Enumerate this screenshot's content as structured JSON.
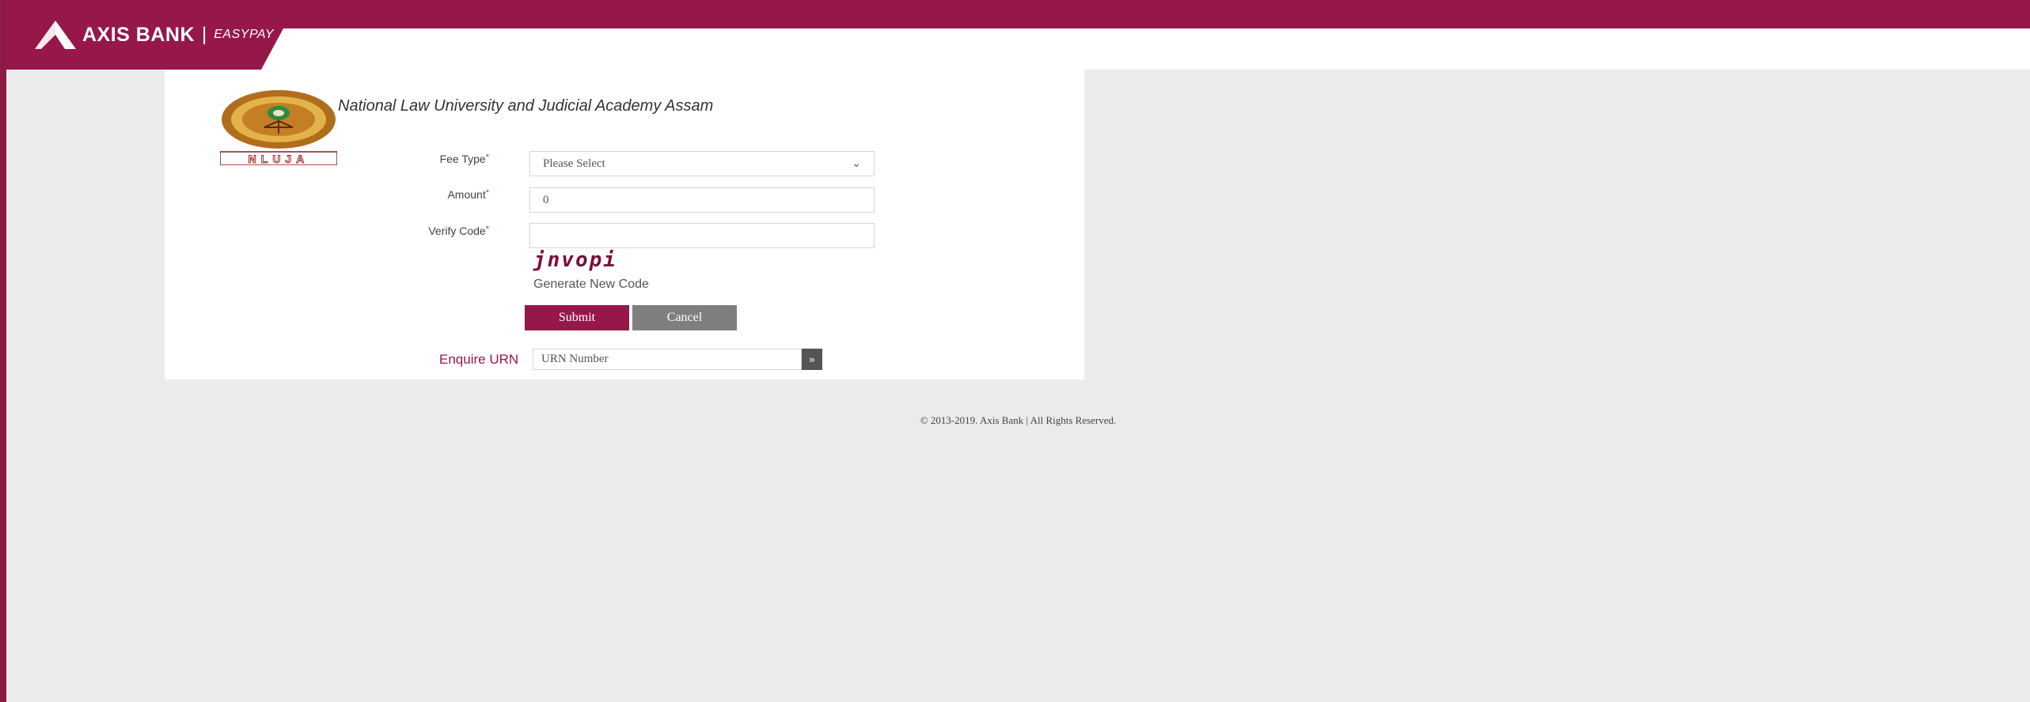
{
  "header": {
    "brand_name": "AXIS BANK",
    "brand_separator": "|",
    "brand_sub": "EASYPAY",
    "logo_icon": "axis-bank-logo-icon",
    "colors": {
      "brand": "#96174a",
      "background": "#ebebeb"
    }
  },
  "institution": {
    "name": "National Law University and Judicial Academy Assam",
    "logo_icon": "nlu-assam-seal-icon",
    "logo_text": "NLUJA"
  },
  "form": {
    "fee_type": {
      "label": "Fee Type",
      "required_mark": "*",
      "value": "Please Select"
    },
    "amount": {
      "label": "Amount",
      "required_mark": "*",
      "value": "0"
    },
    "verify_code": {
      "label": "Verify Code",
      "required_mark": "*",
      "value": ""
    },
    "captcha_text": "jnvopi",
    "generate_code_label": "Generate New Code",
    "submit_label": "Submit",
    "cancel_label": "Cancel"
  },
  "enquire": {
    "label": "Enquire URN",
    "placeholder": "URN Number",
    "go_label": "»"
  },
  "footer": {
    "copyright": "© 2013-2019. Axis Bank | All Rights Reserved."
  }
}
